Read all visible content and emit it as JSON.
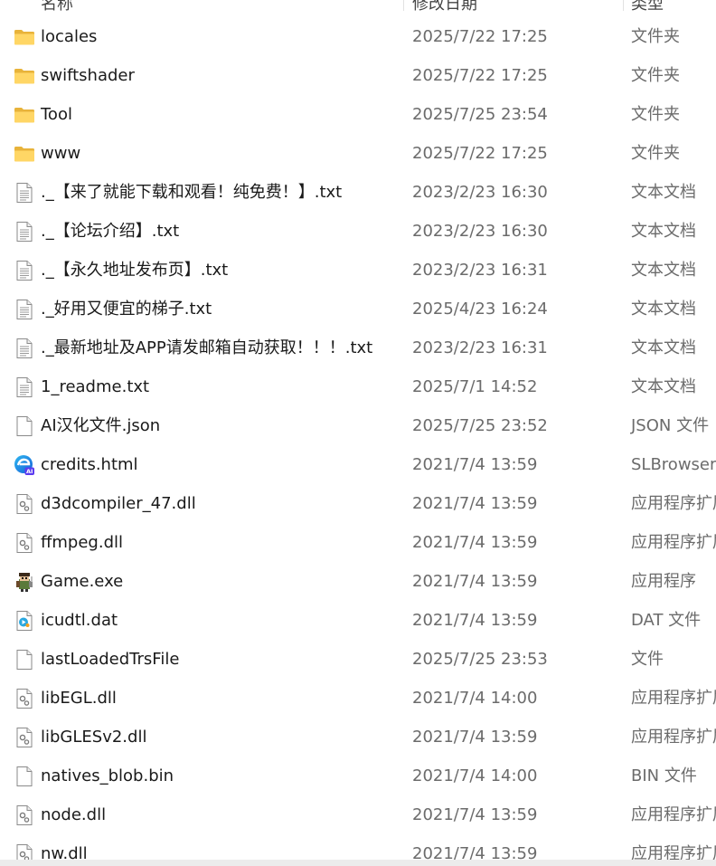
{
  "header": {
    "name_label": "名称",
    "date_label": "修改日期",
    "type_label": "类型"
  },
  "files": [
    {
      "name": "locales",
      "date": "2025/7/22 17:25",
      "type": "文件夹",
      "icon": "folder-icon"
    },
    {
      "name": "swiftshader",
      "date": "2025/7/22 17:25",
      "type": "文件夹",
      "icon": "folder-icon"
    },
    {
      "name": "Tool",
      "date": "2025/7/25 23:54",
      "type": "文件夹",
      "icon": "folder-icon"
    },
    {
      "name": "www",
      "date": "2025/7/22 17:25",
      "type": "文件夹",
      "icon": "folder-icon"
    },
    {
      "name": "._【来了就能下载和观看！纯免费！】.txt",
      "date": "2023/2/23 16:30",
      "type": "文本文档",
      "icon": "text-file-icon"
    },
    {
      "name": "._【论坛介绍】.txt",
      "date": "2023/2/23 16:30",
      "type": "文本文档",
      "icon": "text-file-icon"
    },
    {
      "name": "._【永久地址发布页】.txt",
      "date": "2023/2/23 16:31",
      "type": "文本文档",
      "icon": "text-file-icon"
    },
    {
      "name": "._好用又便宜的梯子.txt",
      "date": "2025/4/23 16:24",
      "type": "文本文档",
      "icon": "text-file-icon"
    },
    {
      "name": "._最新地址及APP请发邮箱自动获取！！！.txt",
      "date": "2023/2/23 16:31",
      "type": "文本文档",
      "icon": "text-file-icon"
    },
    {
      "name": "1_readme.txt",
      "date": "2025/7/1 14:52",
      "type": "文本文档",
      "icon": "text-file-icon"
    },
    {
      "name": "AI汉化文件.json",
      "date": "2025/7/25 23:52",
      "type": "JSON 文件",
      "icon": "blank-file-icon"
    },
    {
      "name": "credits.html",
      "date": "2021/7/4 13:59",
      "type": "SLBrowser",
      "icon": "browser-html-icon"
    },
    {
      "name": "d3dcompiler_47.dll",
      "date": "2021/7/4 13:59",
      "type": "应用程序扩展",
      "icon": "dll-file-icon"
    },
    {
      "name": "ffmpeg.dll",
      "date": "2021/7/4 13:59",
      "type": "应用程序扩展",
      "icon": "dll-file-icon"
    },
    {
      "name": "Game.exe",
      "date": "2021/7/4 13:59",
      "type": "应用程序",
      "icon": "game-exe-icon"
    },
    {
      "name": "icudtl.dat",
      "date": "2021/7/4 13:59",
      "type": "DAT 文件",
      "icon": "media-dat-icon"
    },
    {
      "name": "lastLoadedTrsFile",
      "date": "2025/7/25 23:53",
      "type": "文件",
      "icon": "blank-file-icon"
    },
    {
      "name": "libEGL.dll",
      "date": "2021/7/4 14:00",
      "type": "应用程序扩展",
      "icon": "dll-file-icon"
    },
    {
      "name": "libGLESv2.dll",
      "date": "2021/7/4 13:59",
      "type": "应用程序扩展",
      "icon": "dll-file-icon"
    },
    {
      "name": "natives_blob.bin",
      "date": "2021/7/4 14:00",
      "type": "BIN 文件",
      "icon": "blank-file-icon"
    },
    {
      "name": "node.dll",
      "date": "2021/7/4 13:59",
      "type": "应用程序扩展",
      "icon": "dll-file-icon"
    },
    {
      "name": "nw.dll",
      "date": "2021/7/4 13:59",
      "type": "应用程序扩展",
      "icon": "dll-file-icon"
    }
  ]
}
